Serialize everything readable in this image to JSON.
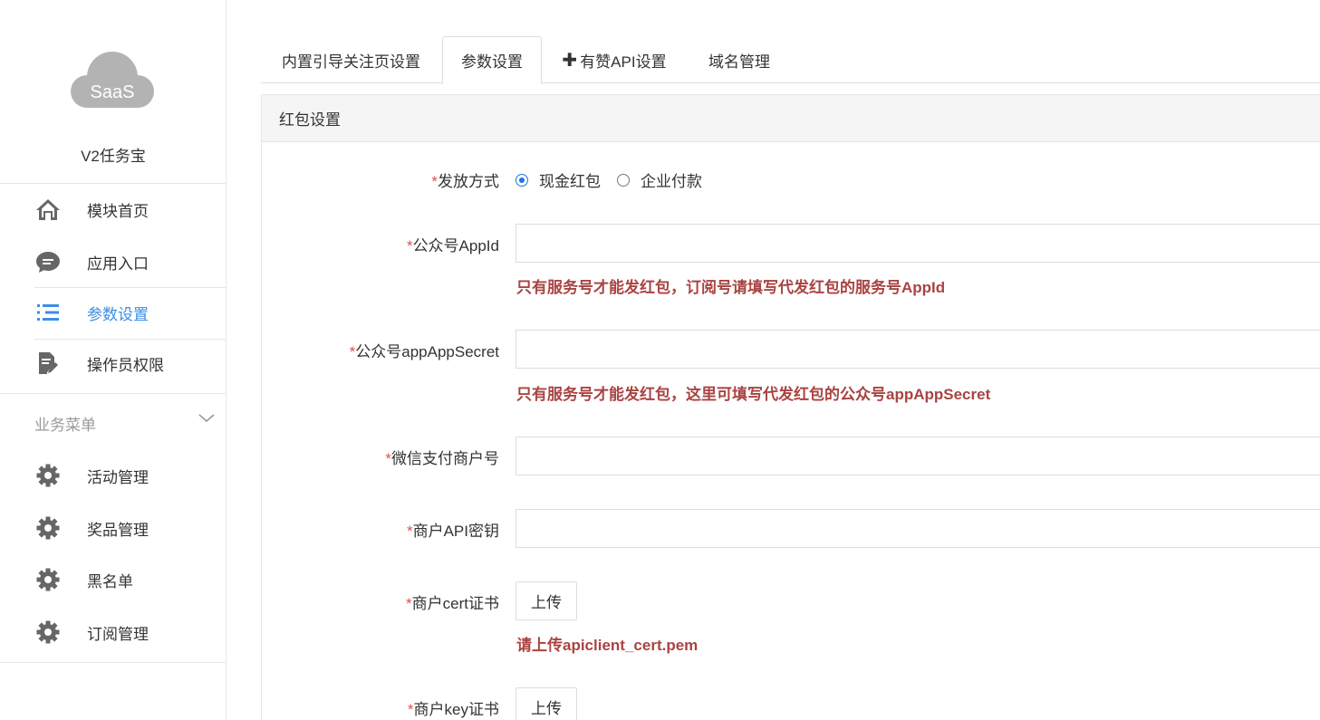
{
  "sidebar": {
    "logo_text": "SaaS",
    "app_name": "V2任务宝",
    "items": [
      {
        "label": "模块首页",
        "icon": "home-icon"
      },
      {
        "label": "应用入口",
        "icon": "chat-icon"
      },
      {
        "label": "参数设置",
        "icon": "list-icon",
        "active": true
      },
      {
        "label": "操作员权限",
        "icon": "document-edit-icon"
      }
    ],
    "group": {
      "title": "业务菜单",
      "items": [
        {
          "label": "活动管理",
          "icon": "gear-icon"
        },
        {
          "label": "奖品管理",
          "icon": "gear-icon"
        },
        {
          "label": "黑名单",
          "icon": "gear-icon"
        },
        {
          "label": "订阅管理",
          "icon": "gear-icon"
        }
      ]
    }
  },
  "tabs": [
    {
      "label": "内置引导关注页设置"
    },
    {
      "label": "参数设置",
      "active": true
    },
    {
      "label": "有赞API设置",
      "icon": "plus-icon"
    },
    {
      "label": "域名管理"
    }
  ],
  "panel": {
    "title": "红包设置",
    "required_mark": "*",
    "fields": {
      "send_method": {
        "label": "发放方式",
        "options": [
          {
            "label": "现金红包",
            "checked": true
          },
          {
            "label": "企业付款",
            "checked": false
          }
        ]
      },
      "appid": {
        "label": "公众号AppId",
        "value": "",
        "hint": "只有服务号才能发红包，订阅号请填写代发红包的服务号AppId"
      },
      "secret": {
        "label": "公众号appAppSecret",
        "value": "",
        "hint": "只有服务号才能发红包，这里可填写代发红包的公众号appAppSecret"
      },
      "mch_id": {
        "label": "微信支付商户号",
        "value": ""
      },
      "api_key": {
        "label": "商户API密钥",
        "value": ""
      },
      "cert": {
        "label": "商户cert证书",
        "button": "上传",
        "hint": "请上传apiclient_cert.pem"
      },
      "key": {
        "label": "商户key证书",
        "button": "上传"
      }
    }
  },
  "colors": {
    "accent": "#3a8ee6",
    "required": "#d9534f",
    "hint": "#a94442",
    "icon_gray": "#666666"
  }
}
